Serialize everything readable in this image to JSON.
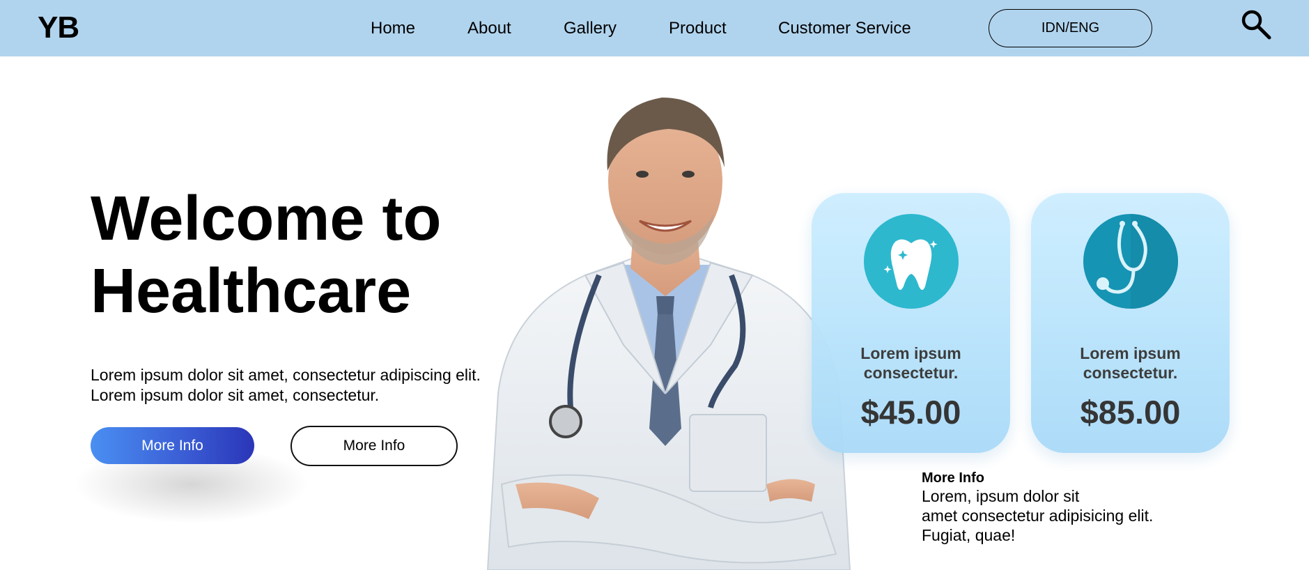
{
  "header": {
    "logo": "YB",
    "nav": [
      "Home",
      "About",
      "Gallery",
      "Product",
      "Customer Service"
    ],
    "language_button": "IDN/ENG",
    "search_icon": "search-icon"
  },
  "hero": {
    "title_line1": "Welcome to",
    "title_line2": "Healthcare",
    "desc_line1": "Lorem ipsum dolor sit amet, consectetur adipiscing elit.",
    "desc_line2": "Lorem ipsum dolor sit amet, consectetur.",
    "primary_button": "More Info",
    "secondary_button": "More Info"
  },
  "cards": [
    {
      "icon": "tooth-icon",
      "title_line1": "Lorem ipsum",
      "title_line2": "consectetur.",
      "price": "$45.00"
    },
    {
      "icon": "stethoscope-icon",
      "title_line1": "Lorem ipsum",
      "title_line2": "consectetur.",
      "price": "$85.00"
    }
  ],
  "more_info": {
    "heading": "More Info",
    "text": "Lorem, ipsum dolor sit\namet consectetur adipisicing elit.\nFugiat, quae!"
  },
  "colors": {
    "navbar": "#b1d4ee",
    "primary_button_start": "#4a8ff2",
    "primary_button_end": "#2a36b8",
    "card": "#b6e2fb",
    "tooth_circle": "#22b5cc",
    "stethoscope_circle": "#0a8fb0"
  }
}
